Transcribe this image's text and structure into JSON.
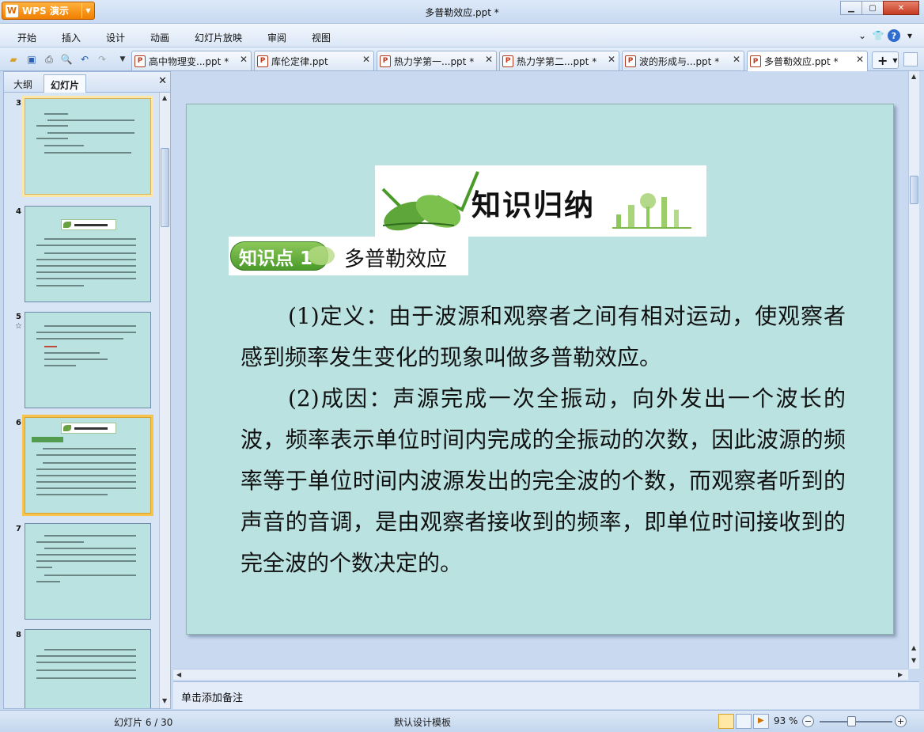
{
  "app": {
    "button_label": "WPS 演示",
    "window_title": "多普勒效应.ppt *"
  },
  "menu": [
    "开始",
    "插入",
    "设计",
    "动画",
    "幻灯片放映",
    "审阅",
    "视图"
  ],
  "tabs": [
    {
      "label": "高中物理变...ppt *",
      "active": false
    },
    {
      "label": "库伦定律.ppt",
      "active": false
    },
    {
      "label": "热力学第一...ppt *",
      "active": false
    },
    {
      "label": "热力学第二...ppt *",
      "active": false
    },
    {
      "label": "波的形成与...ppt *",
      "active": false
    },
    {
      "label": "多普勒效应.ppt *",
      "active": true
    }
  ],
  "left_panel": {
    "tab_outline": "大纲",
    "tab_slides": "幻灯片"
  },
  "thumbnails": [
    "3",
    "4",
    "5",
    "6",
    "7",
    "8"
  ],
  "slide": {
    "banner_title": "知识归纳",
    "point_label": "知识点 1",
    "point_title": "多普勒效应",
    "para1": "(1)定义：由于波源和观察者之间有相对运动，使观察者感到频率发生变化的现象叫做多普勒效应。",
    "para2": "(2)成因：声源完成一次全振动，向外发出一个波长的波，频率表示单位时间内完成的全振动的次数，因此波源的频率等于单位时间内波源发出的完全波的个数，而观察者听到的声音的音调，是由观察者接收到的频率，即单位时间接收到的完全波的个数决定的。"
  },
  "notes_placeholder": "单击添加备注",
  "status": {
    "slide_counter": "幻灯片 6 / 30",
    "template": "默认设计模板",
    "zoom": "93 %"
  },
  "colors": {
    "slide_bg": "#b9e2e1",
    "accent_orange": "#f07f00",
    "selection": "#f7c34b"
  }
}
